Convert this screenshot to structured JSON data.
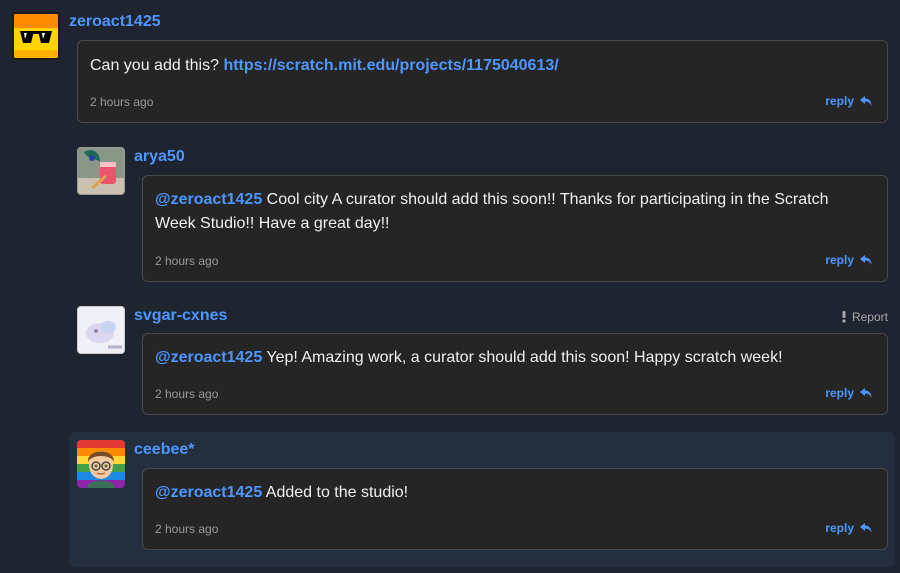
{
  "colors": {
    "background": "#1e2430",
    "bubble": "#252525",
    "link": "#4d97ff",
    "highlight": "#232e3f"
  },
  "comments": [
    {
      "username": "zeroact1425",
      "avatar": "sunglasses-avatar",
      "text": "Can you add this?",
      "link": "https://scratch.mit.edu/projects/1175040613/",
      "time": "2 hours ago",
      "reply_label": "reply"
    },
    {
      "username": "arya50",
      "avatar": "peacock-drink-avatar",
      "mention": "@zeroact1425",
      "text": "Cool city A curator should add this soon!! Thanks for participating in the Scratch Week Studio!! Have a great day!!",
      "time": "2 hours ago",
      "reply_label": "reply"
    },
    {
      "username": "svgar-cxnes",
      "avatar": "pastel-cat-avatar",
      "report_label": "Report",
      "mention": "@zeroact1425",
      "text": "Yep! Amazing work, a curator should add this soon! Happy scratch week!",
      "time": "2 hours ago",
      "reply_label": "reply"
    },
    {
      "username": "ceebee*",
      "avatar": "rainbow-boy-avatar",
      "mention": "@zeroact1425",
      "text": "Added to the studio!",
      "time": "2 hours ago",
      "reply_label": "reply"
    }
  ]
}
